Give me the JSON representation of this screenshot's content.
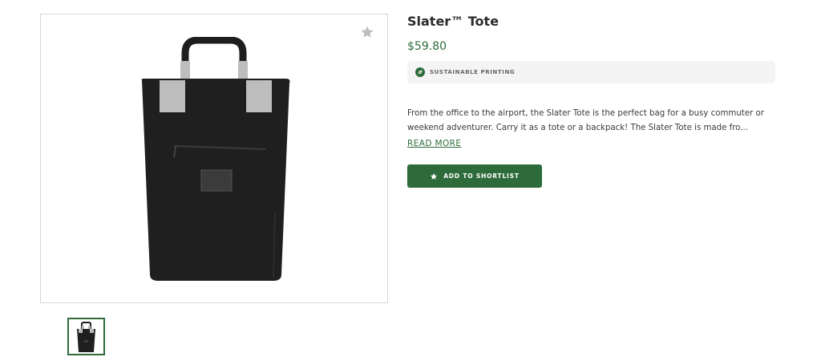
{
  "product": {
    "title": "Slater™ Tote",
    "price": "$59.80",
    "badge": {
      "label": "SUSTAINABLE PRINTING",
      "icon": "leaf-icon",
      "icon_color": "#2e6b3a"
    },
    "description": "From the office to the airport, the Slater Tote is the perfect bag for a busy commuter or weekend adventurer. Carry it as a tote or a backpack! The Slater Tote is made fro...",
    "read_more_label": "READ MORE",
    "shortlist_button_label": "ADD TO SHORTLIST",
    "favorite_icon": "star-icon"
  },
  "gallery": {
    "main_image_alt": "black tote bag with gray handles",
    "thumbnail_count": 1
  },
  "colors": {
    "accent": "#2e6b3a",
    "badge_bg": "#f4f4f4",
    "border": "#d6d6d6"
  }
}
